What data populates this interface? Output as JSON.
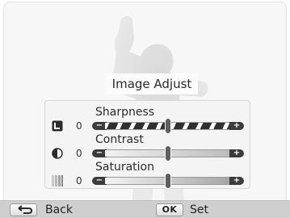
{
  "title": "Image Adjust",
  "rows": [
    {
      "label": "Sharpness",
      "value": "0",
      "level": 0.5,
      "icon": "sharpness-icon"
    },
    {
      "label": "Contrast",
      "value": "0",
      "level": 0.5,
      "icon": "contrast-icon"
    },
    {
      "label": "Saturation",
      "value": "0",
      "level": 0.5,
      "icon": "saturation-icon"
    }
  ],
  "bottom_bar": {
    "back": {
      "key": "↩",
      "label": "Back",
      "icon": "return-arrow-icon"
    },
    "set": {
      "key": "OK",
      "label": "Set"
    }
  }
}
